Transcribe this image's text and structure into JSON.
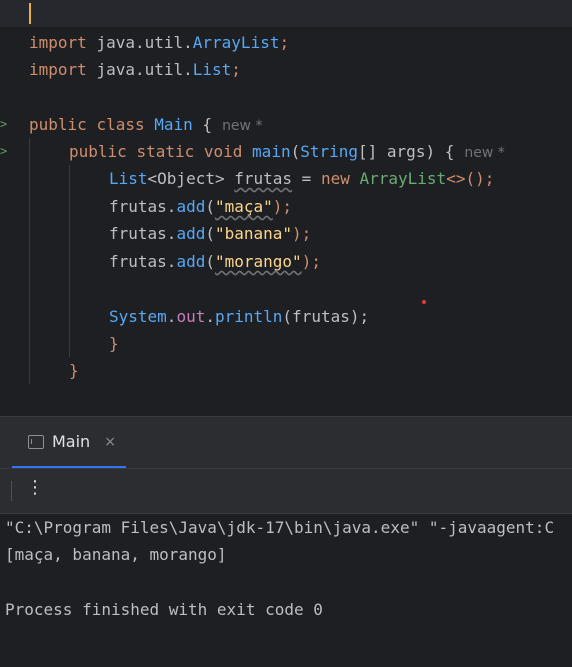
{
  "editor": {
    "hint": "new *",
    "code": {
      "import_kw": "import",
      "import1_pkg": "java.util.",
      "import1_cls": "ArrayList",
      "import2_pkg": "java.util.",
      "import2_cls": "List",
      "semi": ";",
      "public_kw": "public",
      "class_kw": "class",
      "class_name": "Main",
      "open_brace": "{",
      "static_kw": "static",
      "void_kw": "void",
      "main_fn": "main",
      "string_type": "String",
      "params_rest": "[] args) {",
      "list_type": "List",
      "object_generic": "<Object>",
      "frutas_var": "frutas",
      "assign": " = ",
      "new_kw": "new",
      "arraylist_ctor": "ArrayList",
      "ctor_rest": "<>();",
      "frutas": "frutas",
      "add_fn": "add",
      "str1": "\"maça\"",
      "str2": "\"banana\"",
      "str3": "\"morango\"",
      "system": "System",
      "out_field": "out",
      "println_fn": "println",
      "println_arg": "(frutas);",
      "close_brace": "}"
    }
  },
  "tool_window": {
    "tab_label": "Main",
    "tab_close": "×",
    "more_icon": "⋮",
    "console_lines": [
      "\"C:\\Program Files\\Java\\jdk-17\\bin\\java.exe\" \"-javaagent:C",
      "[maça, banana, morango]",
      "",
      "Process finished with exit code 0"
    ]
  },
  "colors": {
    "background": "#1e1f22",
    "keyword": "#cf8e6d",
    "function": "#56a8f5",
    "string": "#6aab73",
    "field": "#c77dbb",
    "accent": "#3574f0"
  }
}
